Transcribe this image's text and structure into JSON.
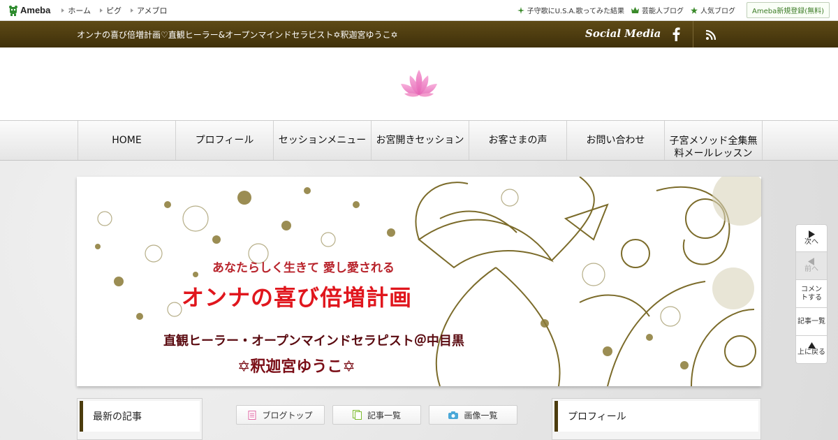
{
  "topbar": {
    "logo": "Ameba",
    "nav": [
      "ホーム",
      "ピグ",
      "アメブロ"
    ],
    "right_links": [
      "子守歌にU.S.A.歌ってみた結果",
      "芸能人ブログ",
      "人気ブログ"
    ],
    "register": "Ameba新規登録(無料)"
  },
  "header": {
    "title": "オンナの喜び倍増計画♡直観ヒーラー&オープンマインドセラピスト✡釈迦宮ゆうこ✡",
    "social_label": "Social Media"
  },
  "global_nav": [
    "HOME",
    "プロフィール",
    "セッションメニュー",
    "お宮開きセッション",
    "お客さまの声",
    "お問い合わせ",
    "子宮メソッド全集無料メールレッスン"
  ],
  "banner": {
    "subtitle": "あなたらしく生きて 愛し愛される",
    "title": "オンナの喜び倍増計画",
    "role": "直観ヒーラー・オープンマインドセラピスト＠中目黒",
    "name": "✡釈迦宮ゆうこ✡"
  },
  "sidebar": {
    "left_heading": "最新の記事",
    "right_heading": "プロフィール"
  },
  "sub_buttons": [
    "ブログトップ",
    "記事一覧",
    "画像一覧"
  ],
  "pager": {
    "next": "次へ",
    "prev": "前へ",
    "comment": "コメントする",
    "list": "記事一覧",
    "top": "上に戻る"
  },
  "colors": {
    "header_brown": "#4a3a10",
    "banner_red": "#e0161d",
    "ameba_green": "#3a7a24"
  }
}
